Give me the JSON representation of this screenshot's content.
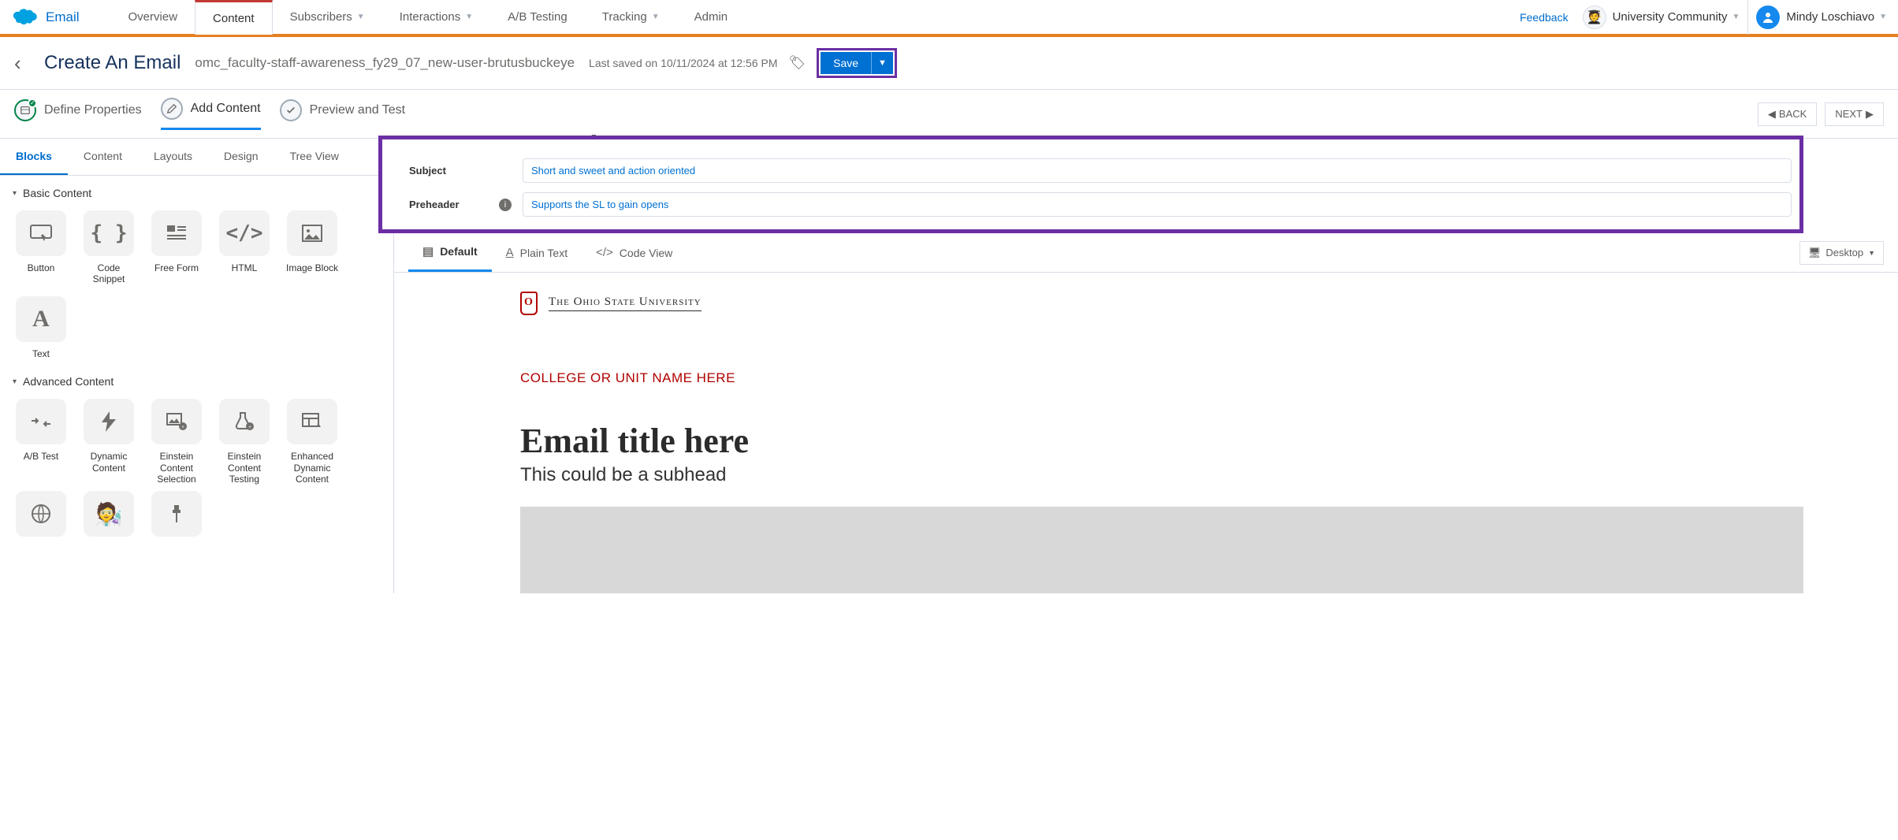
{
  "topnav": {
    "appname": "Email",
    "tabs": [
      {
        "label": "Overview",
        "dropdown": false
      },
      {
        "label": "Content",
        "dropdown": false,
        "active": true
      },
      {
        "label": "Subscribers",
        "dropdown": true
      },
      {
        "label": "Interactions",
        "dropdown": true
      },
      {
        "label": "A/B Testing",
        "dropdown": false
      },
      {
        "label": "Tracking",
        "dropdown": true
      },
      {
        "label": "Admin",
        "dropdown": false
      }
    ],
    "feedback": "Feedback",
    "business_unit": "University Community",
    "user_name": "Mindy Loschiavo"
  },
  "titlebar": {
    "page_title": "Create An Email",
    "email_name": "omc_faculty-staff-awareness_fy29_07_new-user-brutusbuckeye",
    "last_saved": "Last saved on 10/11/2024 at 12:56 PM",
    "save_label": "Save"
  },
  "wizard": {
    "steps": [
      {
        "label": "Define Properties",
        "done": true
      },
      {
        "label": "Add Content",
        "active": true
      },
      {
        "label": "Preview and Test"
      }
    ],
    "back": "BACK",
    "next": "NEXT"
  },
  "left": {
    "tabs": [
      "Blocks",
      "Content",
      "Layouts",
      "Design",
      "Tree View"
    ],
    "active_tab": "Blocks",
    "basic_head": "Basic Content",
    "basic": [
      {
        "label": "Button",
        "icon": "button-icon"
      },
      {
        "label": "Code Snippet",
        "icon": "braces-icon"
      },
      {
        "label": "Free Form",
        "icon": "freeform-icon"
      },
      {
        "label": "HTML",
        "icon": "html-icon"
      },
      {
        "label": "Image Block",
        "icon": "image-icon"
      },
      {
        "label": "Text",
        "icon": "text-icon"
      }
    ],
    "advanced_head": "Advanced Content",
    "advanced": [
      {
        "label": "A/B Test",
        "icon": "abtest-icon"
      },
      {
        "label": "Dynamic Content",
        "icon": "bolt-icon"
      },
      {
        "label": "Einstein Content Selection",
        "icon": "einstein-select-icon"
      },
      {
        "label": "Einstein Content Testing",
        "icon": "einstein-test-icon"
      },
      {
        "label": "Enhanced Dynamic Content",
        "icon": "edc-icon"
      }
    ],
    "extra": [
      {
        "label": "",
        "icon": "globe-icon"
      },
      {
        "label": "",
        "icon": "einstein-icon"
      },
      {
        "label": "",
        "icon": "pin-icon"
      }
    ]
  },
  "editor": {
    "subject_label": "Subject",
    "subject_value": "Short and sweet and action oriented",
    "preheader_label": "Preheader",
    "preheader_value": "Supports the SL to gain opens",
    "view_tabs": {
      "default": "Default",
      "plain": "Plain Text",
      "code": "Code View"
    },
    "device": "Desktop"
  },
  "email": {
    "brand_text": "The Ohio State University",
    "unit": "COLLEGE OR UNIT NAME HERE",
    "title": "Email title here",
    "subhead": "This could be a subhead"
  }
}
